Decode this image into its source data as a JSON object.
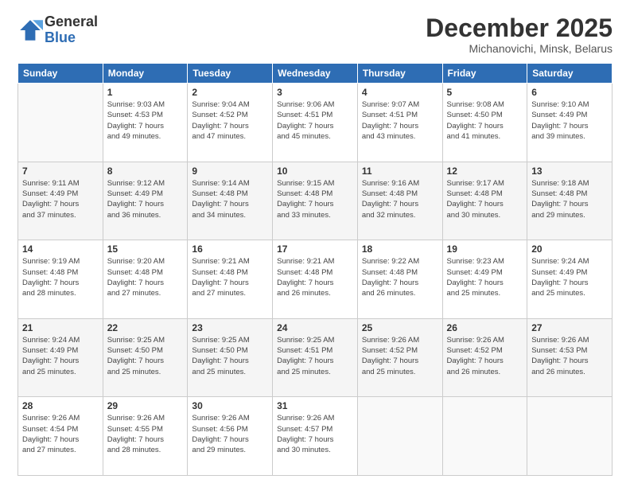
{
  "logo": {
    "general": "General",
    "blue": "Blue"
  },
  "header": {
    "month": "December 2025",
    "location": "Michanovichi, Minsk, Belarus"
  },
  "days_of_week": [
    "Sunday",
    "Monday",
    "Tuesday",
    "Wednesday",
    "Thursday",
    "Friday",
    "Saturday"
  ],
  "weeks": [
    [
      {
        "day": "",
        "info": ""
      },
      {
        "day": "1",
        "info": "Sunrise: 9:03 AM\nSunset: 4:53 PM\nDaylight: 7 hours\nand 49 minutes."
      },
      {
        "day": "2",
        "info": "Sunrise: 9:04 AM\nSunset: 4:52 PM\nDaylight: 7 hours\nand 47 minutes."
      },
      {
        "day": "3",
        "info": "Sunrise: 9:06 AM\nSunset: 4:51 PM\nDaylight: 7 hours\nand 45 minutes."
      },
      {
        "day": "4",
        "info": "Sunrise: 9:07 AM\nSunset: 4:51 PM\nDaylight: 7 hours\nand 43 minutes."
      },
      {
        "day": "5",
        "info": "Sunrise: 9:08 AM\nSunset: 4:50 PM\nDaylight: 7 hours\nand 41 minutes."
      },
      {
        "day": "6",
        "info": "Sunrise: 9:10 AM\nSunset: 4:49 PM\nDaylight: 7 hours\nand 39 minutes."
      }
    ],
    [
      {
        "day": "7",
        "info": "Sunrise: 9:11 AM\nSunset: 4:49 PM\nDaylight: 7 hours\nand 37 minutes."
      },
      {
        "day": "8",
        "info": "Sunrise: 9:12 AM\nSunset: 4:49 PM\nDaylight: 7 hours\nand 36 minutes."
      },
      {
        "day": "9",
        "info": "Sunrise: 9:14 AM\nSunset: 4:48 PM\nDaylight: 7 hours\nand 34 minutes."
      },
      {
        "day": "10",
        "info": "Sunrise: 9:15 AM\nSunset: 4:48 PM\nDaylight: 7 hours\nand 33 minutes."
      },
      {
        "day": "11",
        "info": "Sunrise: 9:16 AM\nSunset: 4:48 PM\nDaylight: 7 hours\nand 32 minutes."
      },
      {
        "day": "12",
        "info": "Sunrise: 9:17 AM\nSunset: 4:48 PM\nDaylight: 7 hours\nand 30 minutes."
      },
      {
        "day": "13",
        "info": "Sunrise: 9:18 AM\nSunset: 4:48 PM\nDaylight: 7 hours\nand 29 minutes."
      }
    ],
    [
      {
        "day": "14",
        "info": "Sunrise: 9:19 AM\nSunset: 4:48 PM\nDaylight: 7 hours\nand 28 minutes."
      },
      {
        "day": "15",
        "info": "Sunrise: 9:20 AM\nSunset: 4:48 PM\nDaylight: 7 hours\nand 27 minutes."
      },
      {
        "day": "16",
        "info": "Sunrise: 9:21 AM\nSunset: 4:48 PM\nDaylight: 7 hours\nand 27 minutes."
      },
      {
        "day": "17",
        "info": "Sunrise: 9:21 AM\nSunset: 4:48 PM\nDaylight: 7 hours\nand 26 minutes."
      },
      {
        "day": "18",
        "info": "Sunrise: 9:22 AM\nSunset: 4:48 PM\nDaylight: 7 hours\nand 26 minutes."
      },
      {
        "day": "19",
        "info": "Sunrise: 9:23 AM\nSunset: 4:49 PM\nDaylight: 7 hours\nand 25 minutes."
      },
      {
        "day": "20",
        "info": "Sunrise: 9:24 AM\nSunset: 4:49 PM\nDaylight: 7 hours\nand 25 minutes."
      }
    ],
    [
      {
        "day": "21",
        "info": "Sunrise: 9:24 AM\nSunset: 4:49 PM\nDaylight: 7 hours\nand 25 minutes."
      },
      {
        "day": "22",
        "info": "Sunrise: 9:25 AM\nSunset: 4:50 PM\nDaylight: 7 hours\nand 25 minutes."
      },
      {
        "day": "23",
        "info": "Sunrise: 9:25 AM\nSunset: 4:50 PM\nDaylight: 7 hours\nand 25 minutes."
      },
      {
        "day": "24",
        "info": "Sunrise: 9:25 AM\nSunset: 4:51 PM\nDaylight: 7 hours\nand 25 minutes."
      },
      {
        "day": "25",
        "info": "Sunrise: 9:26 AM\nSunset: 4:52 PM\nDaylight: 7 hours\nand 25 minutes."
      },
      {
        "day": "26",
        "info": "Sunrise: 9:26 AM\nSunset: 4:52 PM\nDaylight: 7 hours\nand 26 minutes."
      },
      {
        "day": "27",
        "info": "Sunrise: 9:26 AM\nSunset: 4:53 PM\nDaylight: 7 hours\nand 26 minutes."
      }
    ],
    [
      {
        "day": "28",
        "info": "Sunrise: 9:26 AM\nSunset: 4:54 PM\nDaylight: 7 hours\nand 27 minutes."
      },
      {
        "day": "29",
        "info": "Sunrise: 9:26 AM\nSunset: 4:55 PM\nDaylight: 7 hours\nand 28 minutes."
      },
      {
        "day": "30",
        "info": "Sunrise: 9:26 AM\nSunset: 4:56 PM\nDaylight: 7 hours\nand 29 minutes."
      },
      {
        "day": "31",
        "info": "Sunrise: 9:26 AM\nSunset: 4:57 PM\nDaylight: 7 hours\nand 30 minutes."
      },
      {
        "day": "",
        "info": ""
      },
      {
        "day": "",
        "info": ""
      },
      {
        "day": "",
        "info": ""
      }
    ]
  ]
}
